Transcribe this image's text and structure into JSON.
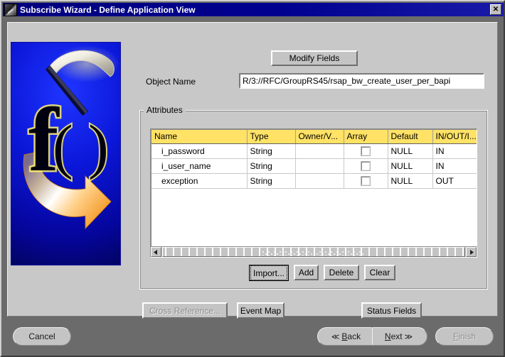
{
  "window": {
    "title": "Subscribe Wizard - Define Application View",
    "icon": "wizard-wand-icon",
    "close_label": "✕"
  },
  "toolbar": {
    "modify_fields_label": "Modify Fields"
  },
  "object_name": {
    "label": "Object Name",
    "value": "R/3://RFC/GroupRS45/rsap_bw_create_user_per_bapi",
    "placeholder": ""
  },
  "attributes": {
    "legend": "Attributes",
    "columns": [
      "Name",
      "Type",
      "Owner/V...",
      "Array",
      "Default",
      "IN/OUT/I..."
    ],
    "rows": [
      {
        "name": "i_password",
        "type": "String",
        "owner": "",
        "array": false,
        "default": "NULL",
        "inout": "IN"
      },
      {
        "name": "i_user_name",
        "type": "String",
        "owner": "",
        "array": false,
        "default": "NULL",
        "inout": "IN"
      },
      {
        "name": "exception",
        "type": "String",
        "owner": "",
        "array": false,
        "default": "NULL",
        "inout": "OUT"
      }
    ],
    "buttons": {
      "import": "Import...",
      "add": "Add",
      "delete": "Delete",
      "clear": "Clear"
    },
    "scrollbar": {
      "left_arrow": "left-arrow-icon",
      "right_arrow": "right-arrow-icon"
    }
  },
  "actions": {
    "cross_reference": "Cross Reference...",
    "event_map": "Event Map",
    "status_fields": "Status Fields"
  },
  "wizard_nav": {
    "cancel": "Cancel",
    "back_chevron": "≪",
    "back_mnemonic": "B",
    "back_rest": "ack",
    "next_mnemonic": "N",
    "next_rest": "ext",
    "next_chevron": "≫",
    "finish_mnemonic": "F",
    "finish_rest": "inish"
  },
  "colors": {
    "titlebar": "#00008f",
    "panel": "#c8c8c8",
    "bottom_bar": "#6b6b6b",
    "table_header": "#ffe266",
    "banner_blue": "#0b17d8",
    "banner_orange": "#f5a21e"
  }
}
